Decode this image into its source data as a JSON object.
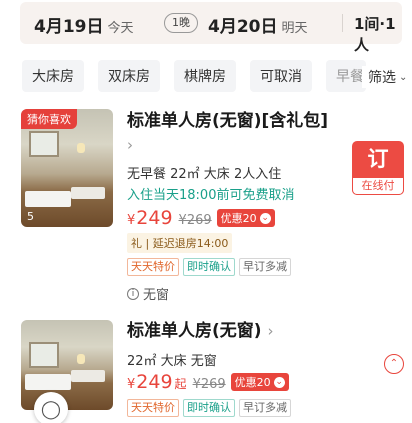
{
  "date_bar": {
    "checkin_date": "4月19日",
    "checkin_weekday": "今天",
    "nights": "1晚",
    "checkout_date": "4月20日",
    "checkout_weekday": "明天",
    "guests": "1间·1人"
  },
  "filters": {
    "chips": [
      "大床房",
      "双床房",
      "棋牌房",
      "可取消",
      "早餐"
    ],
    "screen_label": "筛选",
    "screen_icon": "chevron-down-icon"
  },
  "rooms": [
    {
      "photo_tag": "猜你喜欢",
      "photo_count": "5",
      "title": "标准单人房(无窗)[含礼包]",
      "spec": "无早餐 22㎡ 大床 2人入住",
      "cancel_policy": "入住当天18:00前可免费取消",
      "currency": "¥",
      "price": "249",
      "original_price": "¥269",
      "coupon": "优惠20",
      "gift": "礼 | 延迟退房14:00",
      "badges": [
        "天天特价",
        "即时确认",
        "早订多减"
      ],
      "window_note": "无窗",
      "book_label": "订",
      "book_sub": "在线付"
    },
    {
      "title": "标准单人房(无窗)",
      "spec": "22㎡ 大床 无窗",
      "currency": "¥",
      "price": "249",
      "price_suffix": "起",
      "original_price": "¥269",
      "coupon": "优惠20",
      "badges": [
        "天天特价",
        "即时确认",
        "早订多减"
      ]
    }
  ],
  "colors": {
    "accent": "#e8453c",
    "teal": "#1aa08a"
  }
}
